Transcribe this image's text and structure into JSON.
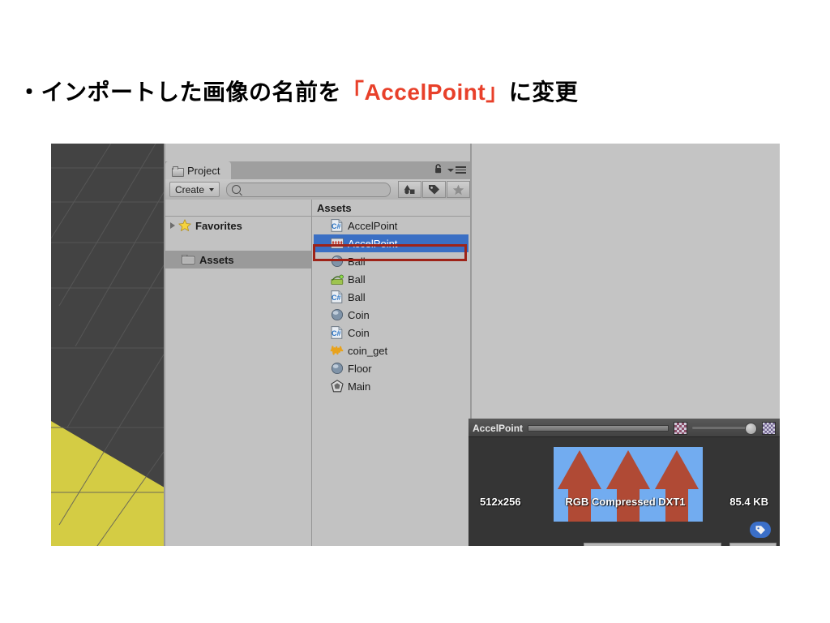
{
  "slide": {
    "title_prefix": "・インポートした画像の名前を",
    "title_accent": "「AccelPoint」",
    "title_suffix": "に変更",
    "accent_color": "#e8402a"
  },
  "project_panel": {
    "tab_label": "Project",
    "tab_icon": "folder-icon",
    "lock_icon": "lock-icon",
    "menu_icon": "hamburger-menu-icon",
    "toolbar": {
      "create_label": "Create",
      "create_caret_icon": "chevron-down-icon",
      "search_placeholder": "",
      "search_value": "",
      "search_icon": "magnifier-icon",
      "buttons": [
        {
          "name": "filter-by-type-button",
          "icon": "shapes-icon"
        },
        {
          "name": "filter-by-label-button",
          "icon": "tag-icon"
        },
        {
          "name": "favorites-filter-button",
          "icon": "star-icon"
        }
      ]
    },
    "tree": {
      "header": "",
      "rows": [
        {
          "label": "Favorites",
          "icon": "star-icon",
          "expandable": true,
          "selected": false
        },
        {
          "label": "Assets",
          "icon": "folder-icon",
          "expandable": false,
          "selected": true
        }
      ]
    },
    "list": {
      "header": "Assets",
      "items": [
        {
          "label": "AccelPoint",
          "icon": "csharp-script-icon",
          "selected": false
        },
        {
          "label": "AccelPoint",
          "icon": "texture-icon",
          "selected": true,
          "annotated": true
        },
        {
          "label": "Ball",
          "icon": "prefab-sphere-icon",
          "selected": false
        },
        {
          "label": "Ball",
          "icon": "physic-material-icon",
          "selected": false
        },
        {
          "label": "Ball",
          "icon": "csharp-script-icon",
          "selected": false
        },
        {
          "label": "Coin",
          "icon": "prefab-sphere-icon",
          "selected": false
        },
        {
          "label": "Coin",
          "icon": "csharp-script-icon",
          "selected": false
        },
        {
          "label": "coin_get",
          "icon": "audio-clip-icon",
          "selected": false
        },
        {
          "label": "Floor",
          "icon": "prefab-sphere-icon",
          "selected": false
        },
        {
          "label": "Main",
          "icon": "unity-scene-icon",
          "selected": false
        }
      ]
    }
  },
  "preview": {
    "title": "AccelPoint",
    "alpha_toggle_icon": "checker-swatch-icon",
    "mip_toggle_icon": "checker-swatch-icon",
    "zoom_slider_value": 100,
    "stats": {
      "dimensions": "512x256",
      "format": "RGB Compressed DXT1",
      "size": "85.4 KB"
    },
    "tag_button_icon": "tag-icon",
    "image": {
      "background_color": "#72acf0",
      "arrow_color": "#b04a35",
      "arrow_count": 3
    }
  },
  "colors": {
    "selection_blue": "#3a6fc4",
    "annotation_red": "#9e2318",
    "panel_gray": "#c2c2c2",
    "scene_gray": "#434343",
    "scene_yellow": "#d4cc44",
    "preview_dark": "#353535"
  }
}
